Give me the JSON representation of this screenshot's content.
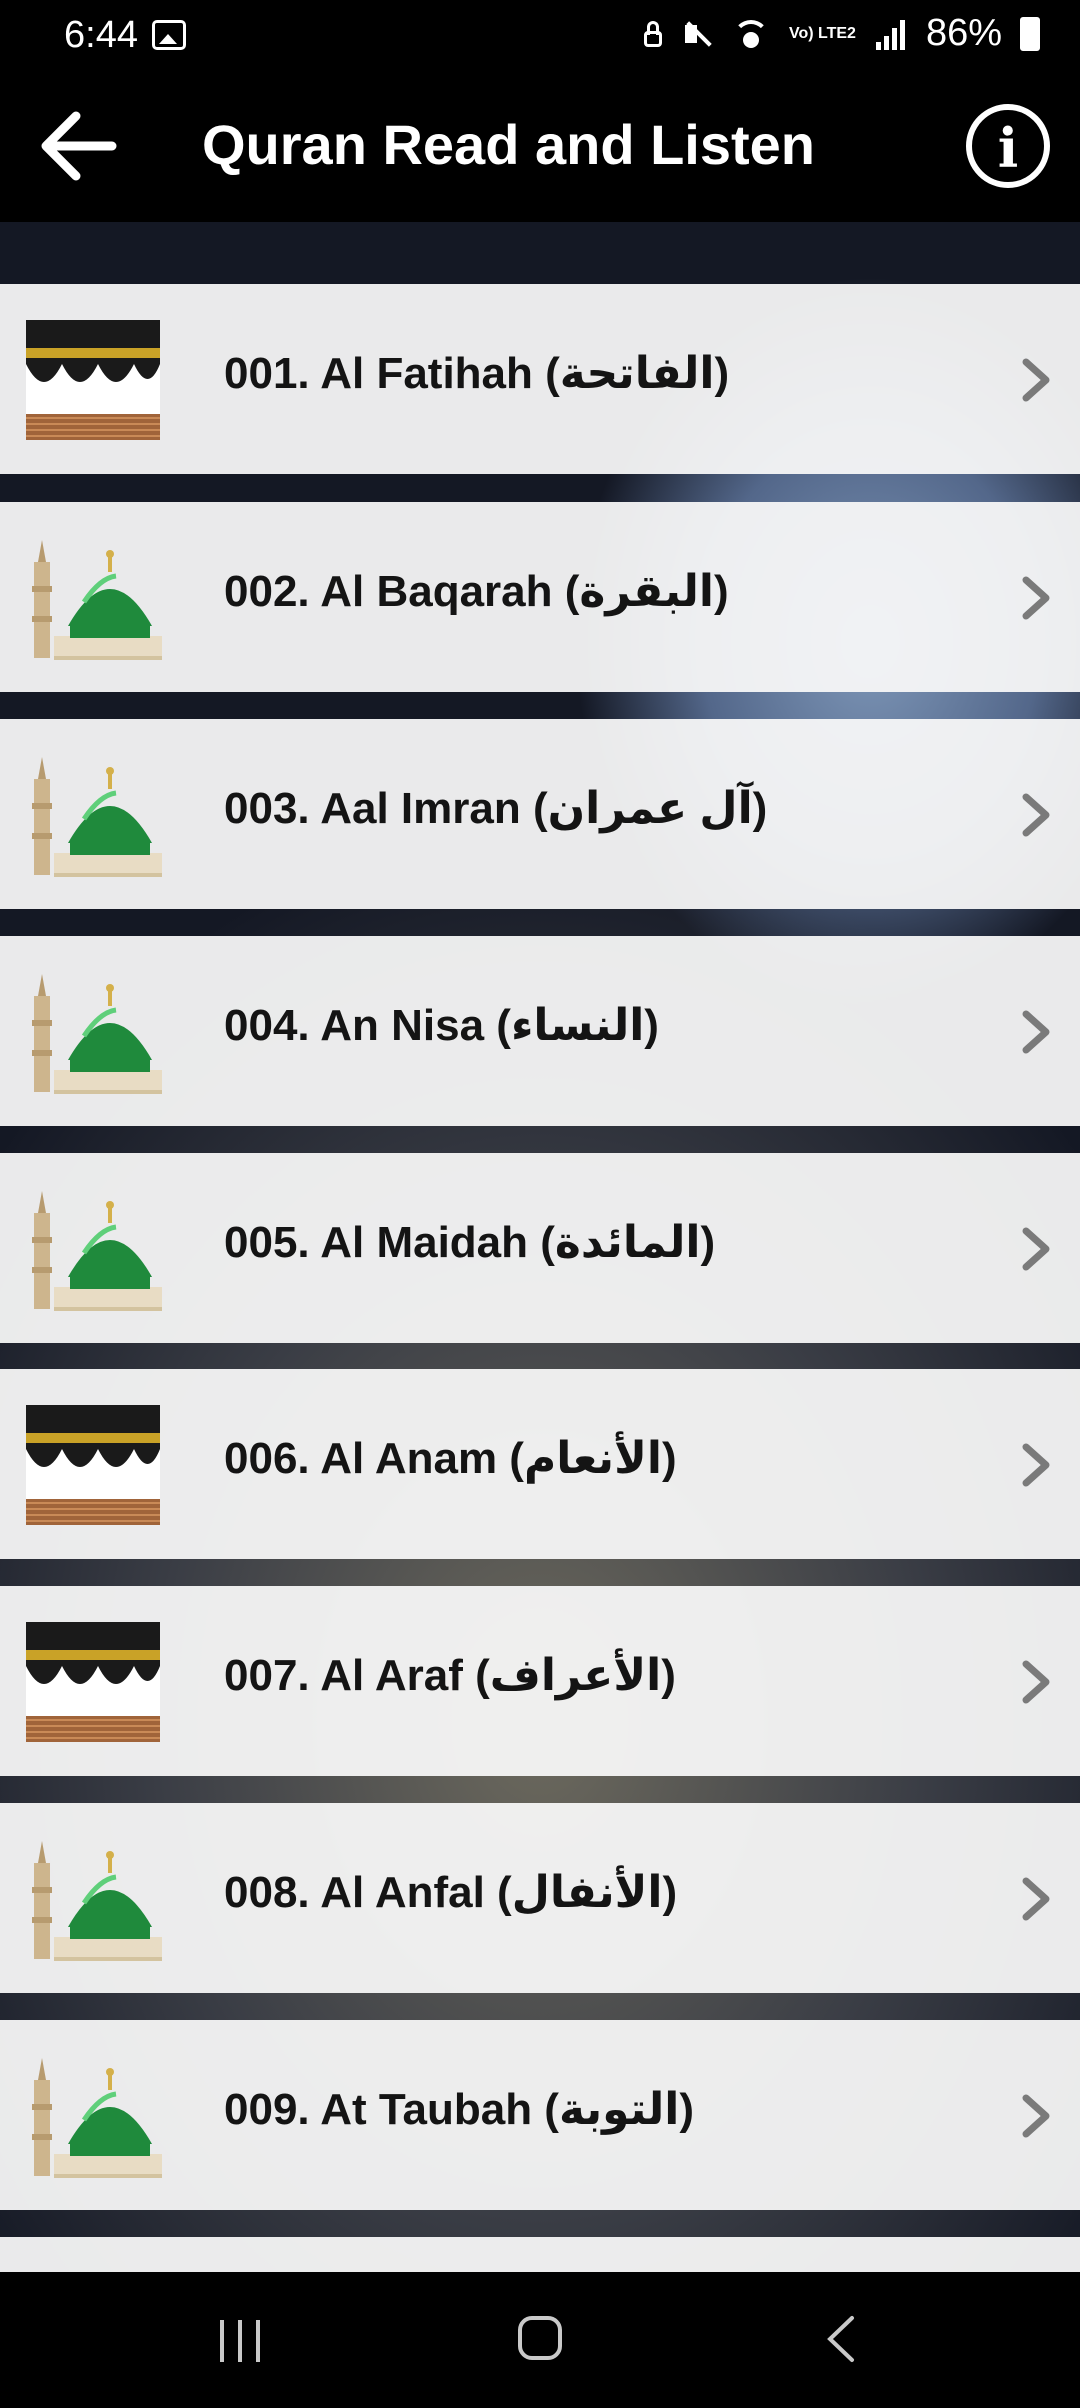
{
  "status_bar": {
    "time": "6:44",
    "network": "Vo) LTE2",
    "battery": "86%"
  },
  "app_bar": {
    "title": "Quran Read and Listen"
  },
  "surahs": [
    {
      "label": "001. Al Fatihah (الفاتحة)",
      "icon": "kaaba-icon"
    },
    {
      "label": "002. Al Baqarah (البقرة)",
      "icon": "green-dome-icon"
    },
    {
      "label": "003. Aal Imran (آل عمران)",
      "icon": "green-dome-icon"
    },
    {
      "label": "004. An Nisa (النساء)",
      "icon": "green-dome-icon"
    },
    {
      "label": "005. Al Maidah (المائدة)",
      "icon": "green-dome-icon"
    },
    {
      "label": "006. Al Anam (الأنعام)",
      "icon": "kaaba-icon"
    },
    {
      "label": "007. Al Araf (الأعراف)",
      "icon": "kaaba-icon"
    },
    {
      "label": "008. Al Anfal (الأنفال)",
      "icon": "green-dome-icon"
    },
    {
      "label": "009. At Taubah (التوبة)",
      "icon": "green-dome-icon"
    }
  ],
  "colors": {
    "bar_background": "#000000",
    "row_background": "#f8f8f8",
    "dome_green": "#1f8a3c",
    "kaaba_gold": "#c9a227"
  }
}
